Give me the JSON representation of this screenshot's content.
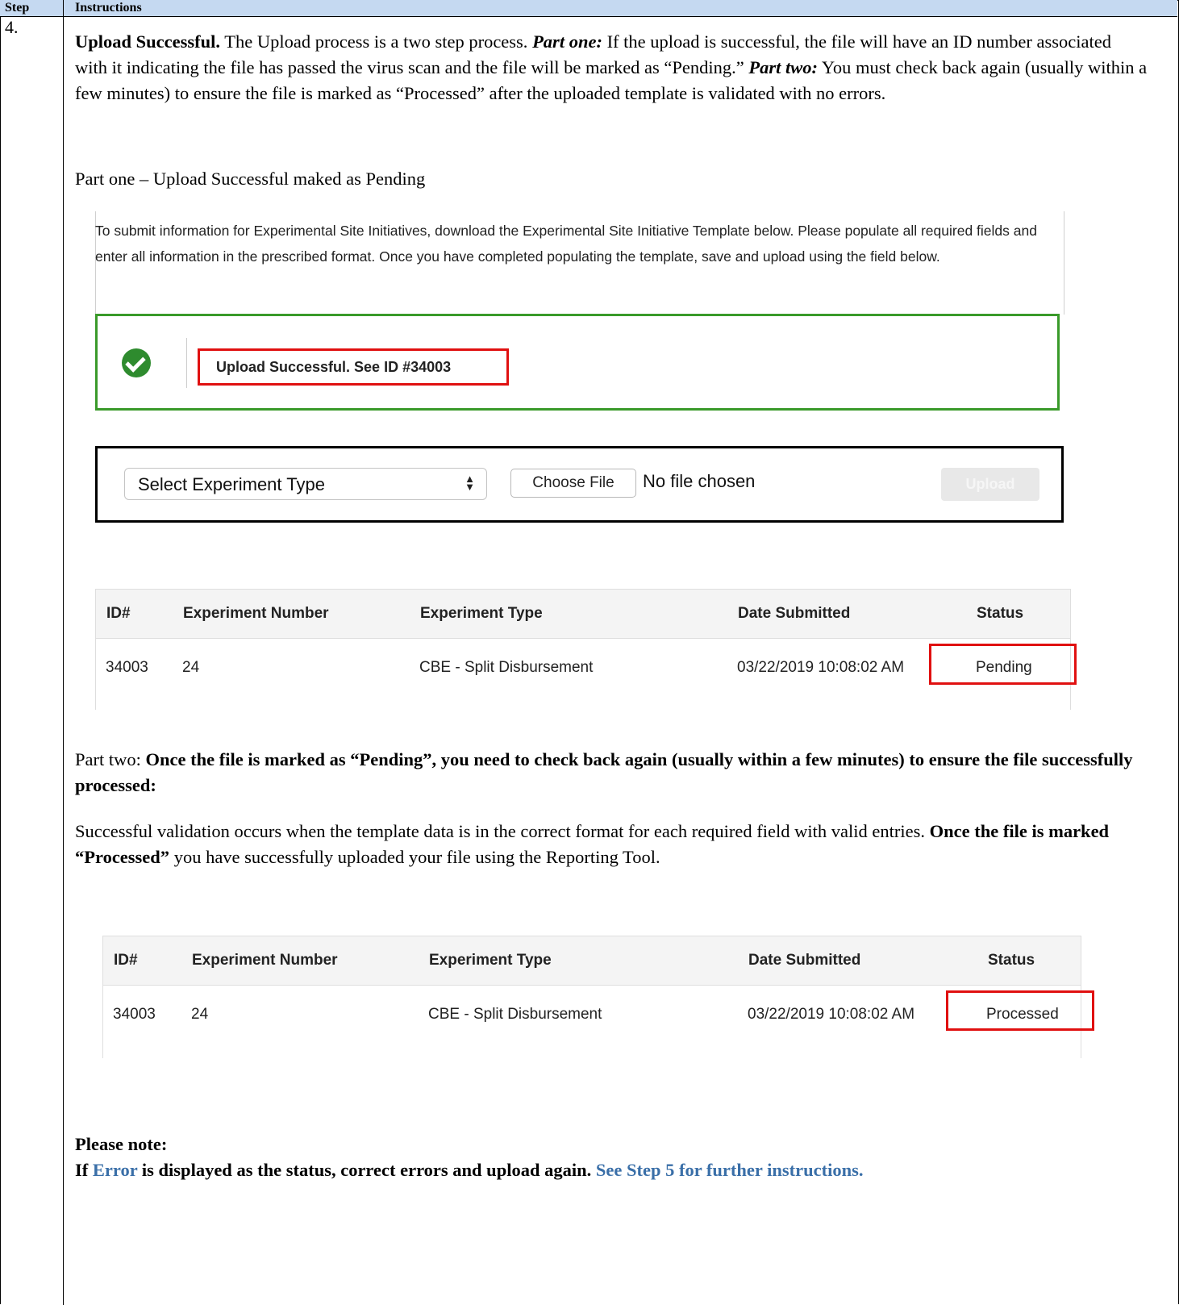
{
  "header": {
    "step": "Step",
    "instructions": "Instructions"
  },
  "step_number": "4.",
  "para1": {
    "lead": "Upload Successful.",
    "t1": " The Upload process is a two step process. ",
    "part_one": "Part one:",
    "t2": "  If the upload is successful, the file will have an ID number associated with it indicating the file has passed the virus scan and the file will be marked as “Pending.” ",
    "part_two": "Part two:",
    "t3": " You must check back again (usually within a few minutes) to ensure the file is marked as “Processed” after the uploaded template is validated with no errors."
  },
  "part_one_caption": "Part one – Upload Successful maked as Pending",
  "upload_page": {
    "intro": "To submit information for Experimental Site Initiatives, download the Experimental Site Initiative Template below. Please populate all required fields and enter all information in the prescribed format. Once you have completed populating the template, save and upload using the field below.",
    "success_message": "Upload Successful. See ID #34003",
    "select_label": "Select Experiment Type",
    "choose_file": "Choose File",
    "no_file": "No file chosen",
    "upload_button": "Upload"
  },
  "table_columns": [
    "ID#",
    "Experiment Number",
    "Experiment Type",
    "Date Submitted",
    "Status"
  ],
  "table_pending": {
    "id": "34003",
    "number": "24",
    "type": "CBE - Split Disbursement",
    "date": "03/22/2019 10:08:02 AM",
    "status": "Pending"
  },
  "part_two": {
    "lead": "Part two: ",
    "bold": "Once the file is marked as “Pending”, you need to check back again (usually within a few minutes) to ensure the file successfully processed:"
  },
  "validation": {
    "t1": "Successful validation occurs when the template data is in the correct format for each required field with valid entries.  ",
    "bold": "Once the file is marked “Processed”",
    "t2": " you have successfully uploaded your file using the Reporting Tool."
  },
  "table_processed": {
    "id": "34003",
    "number": "24",
    "type": "CBE - Split Disbursement",
    "date": "03/22/2019 10:08:02 AM",
    "status": "Processed"
  },
  "note": {
    "title": "Please note:",
    "if": "If ",
    "error": "Error",
    "mid": " is displayed as the status, correct errors and upload again. ",
    "see": "See Step 5 for further instructions."
  },
  "colors": {
    "header_bg": "#c5d9f1",
    "link_blue": "#3a6fa8",
    "highlight_red": "#e01010",
    "success_green": "#3a9a2a"
  }
}
